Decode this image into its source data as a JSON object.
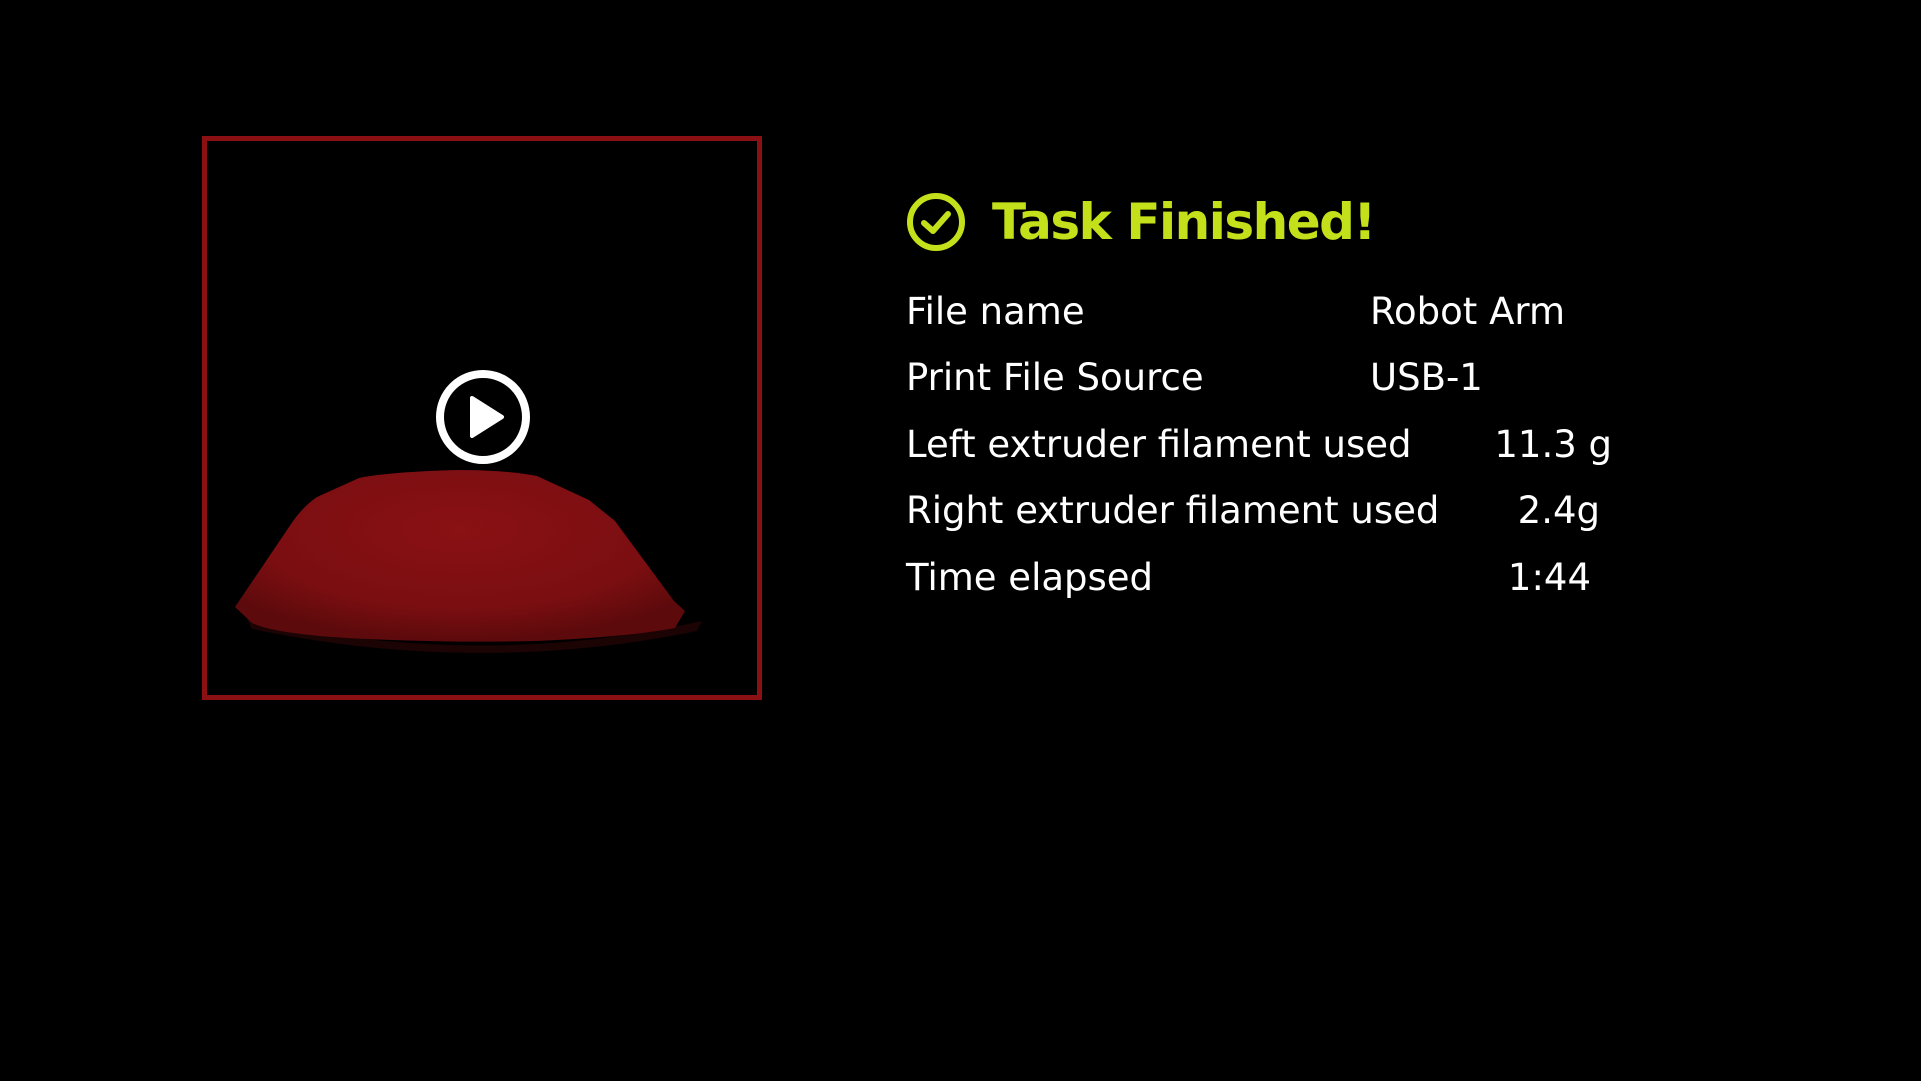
{
  "colors": {
    "background": "#000000",
    "accent_green": "#c3e01a",
    "frame_red": "#8b1014",
    "model_red": "#7e0f12",
    "text": "#ffffff"
  },
  "preview": {
    "play_icon": "play-circle-icon",
    "model": "red dome print model"
  },
  "status": {
    "icon": "check-circle-icon",
    "title": "Task Finished!"
  },
  "details": [
    {
      "label": "File name",
      "value": "Robot Arm"
    },
    {
      "label": "Print File Source",
      "value": "USB-1"
    },
    {
      "label": "Left extruder filament used",
      "value": "11.3 g"
    },
    {
      "label": "Right extruder filament used",
      "value": "2.4g"
    },
    {
      "label": "Time elapsed",
      "value": "1:44"
    }
  ]
}
